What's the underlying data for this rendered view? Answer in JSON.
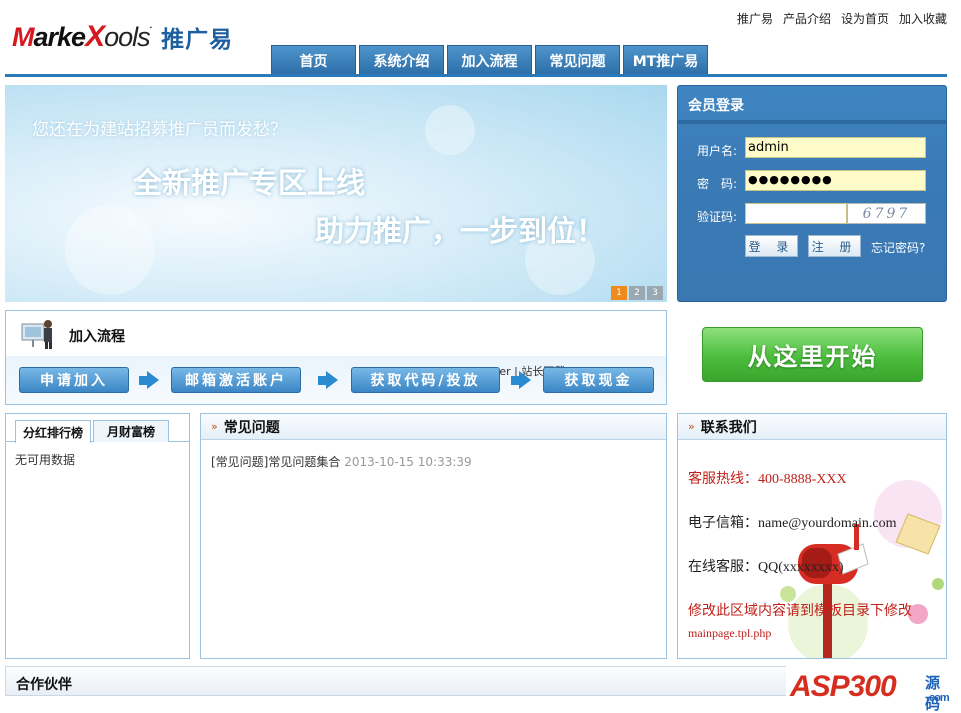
{
  "header": {
    "logo_text": "MarketTools",
    "logo_cn": "推广易",
    "top_links": [
      "推广易",
      "产品介绍",
      "设为首页",
      "加入收藏"
    ],
    "nav_tabs": [
      "首页",
      "系统介绍",
      "加入流程",
      "常见问题",
      "MT推广易"
    ]
  },
  "banner": {
    "line1": "您还在为建站招募推广员而发愁？",
    "line2": "全新推广专区上线",
    "line3": "助力推广，一步到位！",
    "pages": [
      "1",
      "2",
      "3"
    ],
    "active_page": "1"
  },
  "login": {
    "title": "会员登录",
    "username_label": "用户名:",
    "username_value": "admin",
    "password_label": "密　码:",
    "password_value": "●●●●●●●●",
    "captcha_label": "验证码:",
    "captcha_value": "",
    "captcha_text": "6797",
    "login_button": "登 录",
    "register_button": "注 册",
    "forgot_link": "忘记密码?"
  },
  "process": {
    "title": "加入流程",
    "watermark": "China Webmaster | 站长下载",
    "steps": [
      "申请加入",
      "邮箱激活账户",
      "获取代码/投放",
      "获取现金"
    ]
  },
  "start_button": "从这里开始",
  "ranking": {
    "tabs": [
      "分红排行榜",
      "月财富榜"
    ],
    "empty_text": "无可用数据"
  },
  "faq": {
    "title": "常见问题",
    "items": [
      {
        "title": "[常见问题]常见问题集合",
        "time": "2013-10-15 10:33:39"
      }
    ]
  },
  "contact": {
    "title": "联系我们",
    "hotline": "客服热线：400-8888-XXX",
    "email": "电子信箱：name@yourdomain.com",
    "qq": "在线客服：QQ(xxxxxxxx)",
    "note": "修改此区域内容请到模板目录下修改",
    "file": "mainpage.tpl.php"
  },
  "partner": {
    "title": "合作伙伴"
  },
  "footer_logo": {
    "text": "ASP300",
    "cn": "源码",
    "domain": ".com"
  },
  "colors": {
    "brand_blue": "#2a79b8",
    "login_bg": "#3a7ab5",
    "start_green": "#4cbd3c",
    "hotline_red": "#c0211c"
  }
}
